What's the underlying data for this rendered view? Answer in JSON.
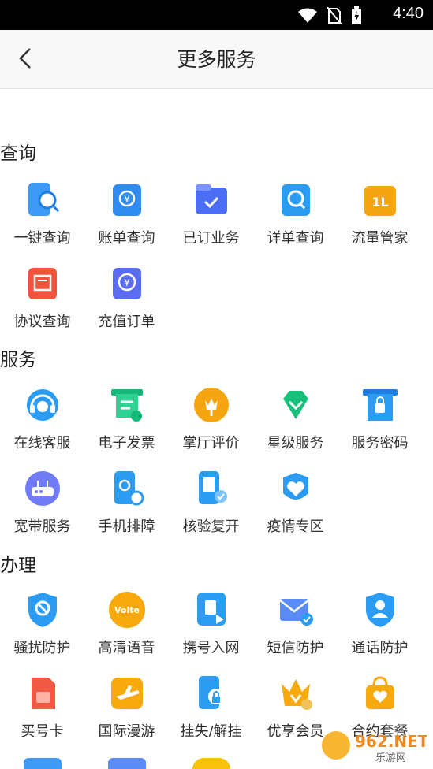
{
  "status": {
    "time": "4:40"
  },
  "header": {
    "title": "更多服务"
  },
  "sections": [
    {
      "title": "查询",
      "items": [
        {
          "label": "一键查询"
        },
        {
          "label": "账单查询"
        },
        {
          "label": "已订业务"
        },
        {
          "label": "详单查询"
        },
        {
          "label": "流量管家"
        },
        {
          "label": "协议查询"
        },
        {
          "label": "充值订单"
        }
      ]
    },
    {
      "title": "服务",
      "items": [
        {
          "label": "在线客服"
        },
        {
          "label": "电子发票"
        },
        {
          "label": "掌厅评价"
        },
        {
          "label": "星级服务"
        },
        {
          "label": "服务密码"
        },
        {
          "label": "宽带服务"
        },
        {
          "label": "手机排障"
        },
        {
          "label": "核验复开"
        },
        {
          "label": "疫情专区"
        }
      ]
    },
    {
      "title": "办理",
      "items": [
        {
          "label": "骚扰防护"
        },
        {
          "label": "高清语音"
        },
        {
          "label": "携号入网"
        },
        {
          "label": "短信防护"
        },
        {
          "label": "通话防护"
        },
        {
          "label": "买号卡"
        },
        {
          "label": "国际漫游"
        },
        {
          "label": "挂失/解挂"
        },
        {
          "label": "优享会员"
        },
        {
          "label": "合约套餐"
        }
      ]
    }
  ],
  "icons": {
    "volte_text": "Volte",
    "flow_text": "1L"
  },
  "watermark": {
    "main": "962.NET",
    "sub": "乐游网"
  }
}
